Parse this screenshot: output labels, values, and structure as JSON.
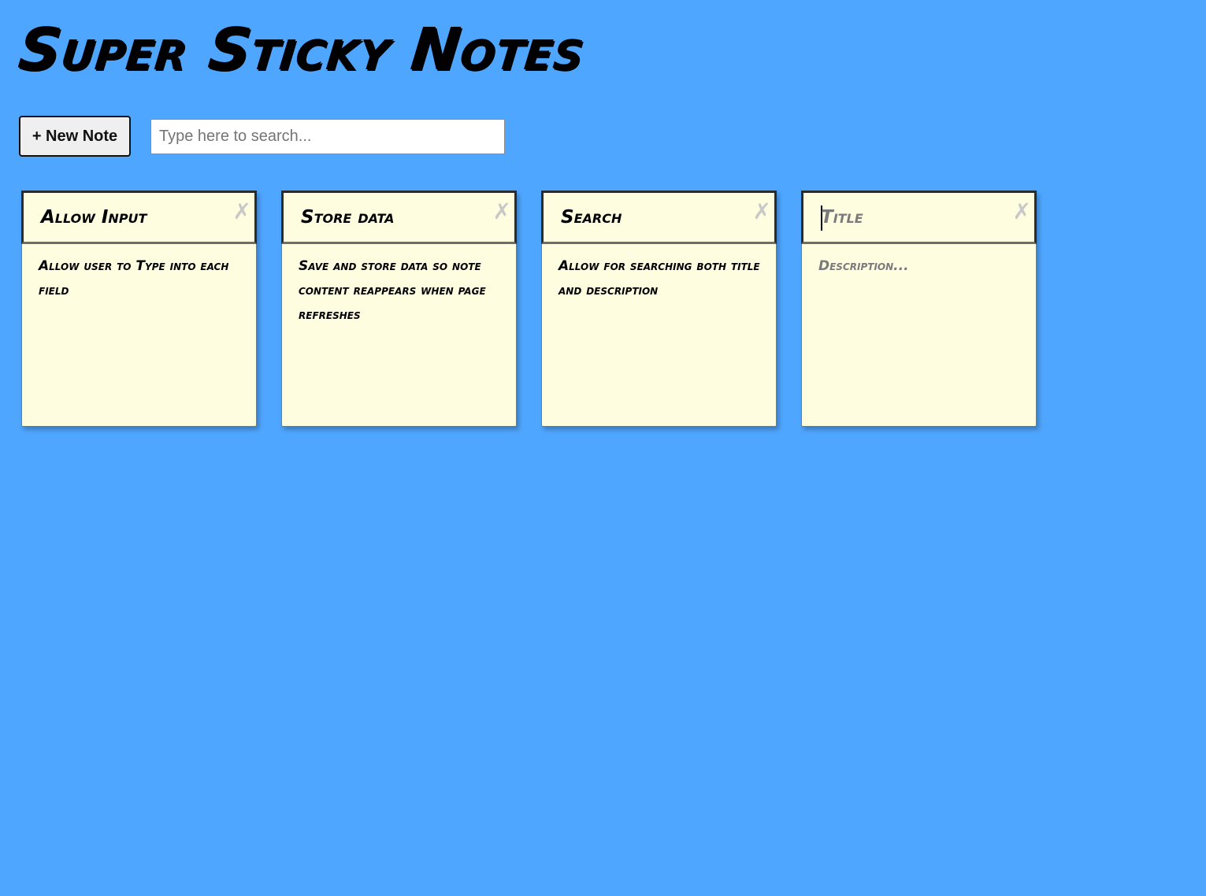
{
  "app": {
    "title": "Super Sticky Notes"
  },
  "toolbar": {
    "new_note_label": "+ New Note",
    "search_placeholder": "Type here to search...",
    "search_value": ""
  },
  "notes": [
    {
      "title": "Allow Input",
      "description": "Allow user to Type into each field",
      "close_icon": "close-icon"
    },
    {
      "title": "Store data",
      "description": "Save and store data so note content reappears when page refreshes",
      "close_icon": "close-icon"
    },
    {
      "title": "Search",
      "description": "Allow for searching both title and description",
      "close_icon": "close-icon"
    },
    {
      "title_placeholder": "Title",
      "description_placeholder": "Description...",
      "close_icon": "close-icon"
    }
  ],
  "colors": {
    "background": "#4fa6ff",
    "note": "#fffde0",
    "close_icon": "#c8c8c8"
  }
}
